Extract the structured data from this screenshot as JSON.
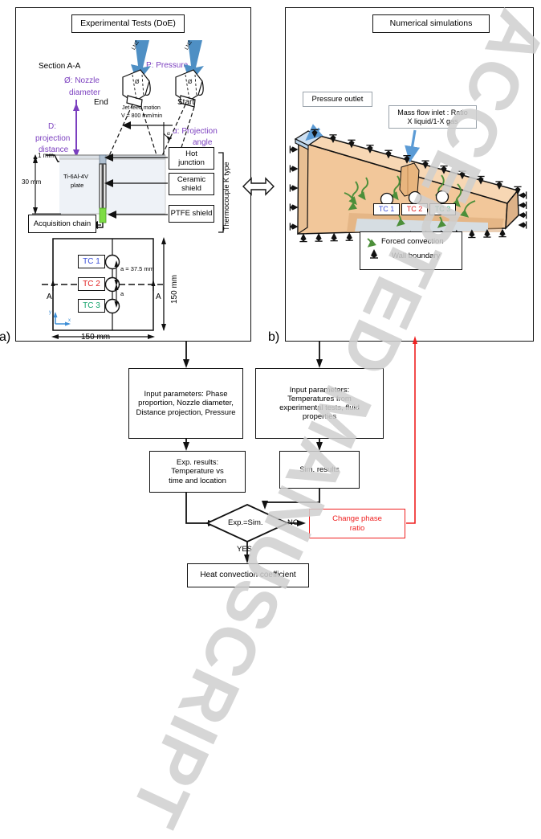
{
  "figure": {
    "panel_a_label": "a)",
    "panel_b_label": "b)"
  },
  "panel_a": {
    "title": "Experimental Tests (DoE)",
    "section_label": "Section A-A",
    "params": {
      "pressure": "P: Pressure",
      "nozzle_diameter_line1": "Ø: Nozzle",
      "nozzle_diameter_line2": "diameter",
      "projection_distance_line1": "D:",
      "projection_distance_line2": "projection",
      "projection_distance_line3": "distance",
      "projection_angle_line1": "α: Projection",
      "projection_angle_line2": "angle"
    },
    "nozzles": {
      "end_label": "End",
      "start_label": "Start",
      "gas_label": "LN2",
      "diameter_symbol": "Ø",
      "feed_motion_line1": "Jet feed motion",
      "feed_motion_line2": "V = 800 mm/min",
      "alpha_symbol": "α"
    },
    "plate": {
      "thickness_top": "1 mm",
      "thickness_total": "30 mm",
      "material_line1": "Ti-6Al-4V",
      "material_line2": "plate"
    },
    "callouts": {
      "hot_junction_line1": "Hot",
      "hot_junction_line2": "junction",
      "ceramic_shield_line1": "Ceramic",
      "ceramic_shield_line2": "shield",
      "ptfe_shield": "PTFE shield",
      "acquisition_chain": "Acquisition chain",
      "thermocouple_type": "Thermocouple K type"
    },
    "top_view": {
      "tc1": "TC 1",
      "tc2": "TC 2",
      "tc3": "TC 3",
      "tc1_color": "#3b4fd8",
      "tc2_color": "#e02020",
      "tc3_color": "#11a36a",
      "spacing_label": "a = 37.5 mm",
      "spacing_short": "a",
      "width_dim": "150 mm",
      "height_dim": "150 mm",
      "section_mark_top": "A",
      "section_mark_bottom": "A",
      "axis_x": "x",
      "axis_y": "y"
    }
  },
  "panel_b": {
    "title": "Numerical simulations",
    "pressure_outlet": "Pressure outlet",
    "mass_flow_line1": "Mass flow inlet : Ratio",
    "mass_flow_line2": "X liquid/1-X gas",
    "tc1": "TC 1",
    "tc2": "TC 2",
    "tc3": "TC 3",
    "legend": {
      "forced_convection": "Forced convection",
      "wall_boundary": "Wall boundary"
    }
  },
  "flowchart": {
    "input_left_line1": "Input parameters: Phase",
    "input_left_line2": "proportion, Nozzle diameter,",
    "input_left_line3": "Distance projection, Pressure",
    "input_right_line1": "Input parameters:",
    "input_right_line2": "Temperatures from",
    "input_right_line3": "experimental tests, fluid",
    "input_right_line4": "properties",
    "exp_results_line1": "Exp. results:",
    "exp_results_line2": "Temperature vs",
    "exp_results_line3": "time and location",
    "sim_results": "Sim. results",
    "decision": "Exp.=Sim.",
    "no_label": "NO",
    "yes_label": "YES",
    "change_phase_line1": "Change phase",
    "change_phase_line2": "ratio",
    "result": "Heat convection coefficient",
    "accent_red": "#ef2020"
  },
  "watermark": {
    "text": "ACCEPTED MANUSCRIPT"
  }
}
